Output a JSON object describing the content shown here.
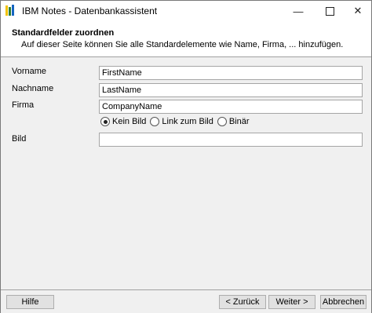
{
  "window": {
    "title": "IBM Notes - Datenbankassistent",
    "minimize": "—",
    "close": "✕"
  },
  "header": {
    "title": "Standardfelder zuordnen",
    "subtitle": "Auf dieser Seite können Sie alle Standardelemente wie Name, Firma, ... hinzufügen."
  },
  "form": {
    "vorname_label": "Vorname",
    "vorname_value": "FirstName",
    "nachname_label": "Nachname",
    "nachname_value": "LastName",
    "firma_label": "Firma",
    "firma_value": "CompanyName",
    "bild_label": "Bild",
    "bild_value": "",
    "bild_options": [
      "Kein Bild",
      "Link zum Bild",
      "Binär"
    ],
    "bild_selected": "Kein Bild"
  },
  "footer": {
    "help": "Hilfe",
    "back": "< Zurück",
    "next": "Weiter >",
    "cancel": "Abbrechen"
  }
}
